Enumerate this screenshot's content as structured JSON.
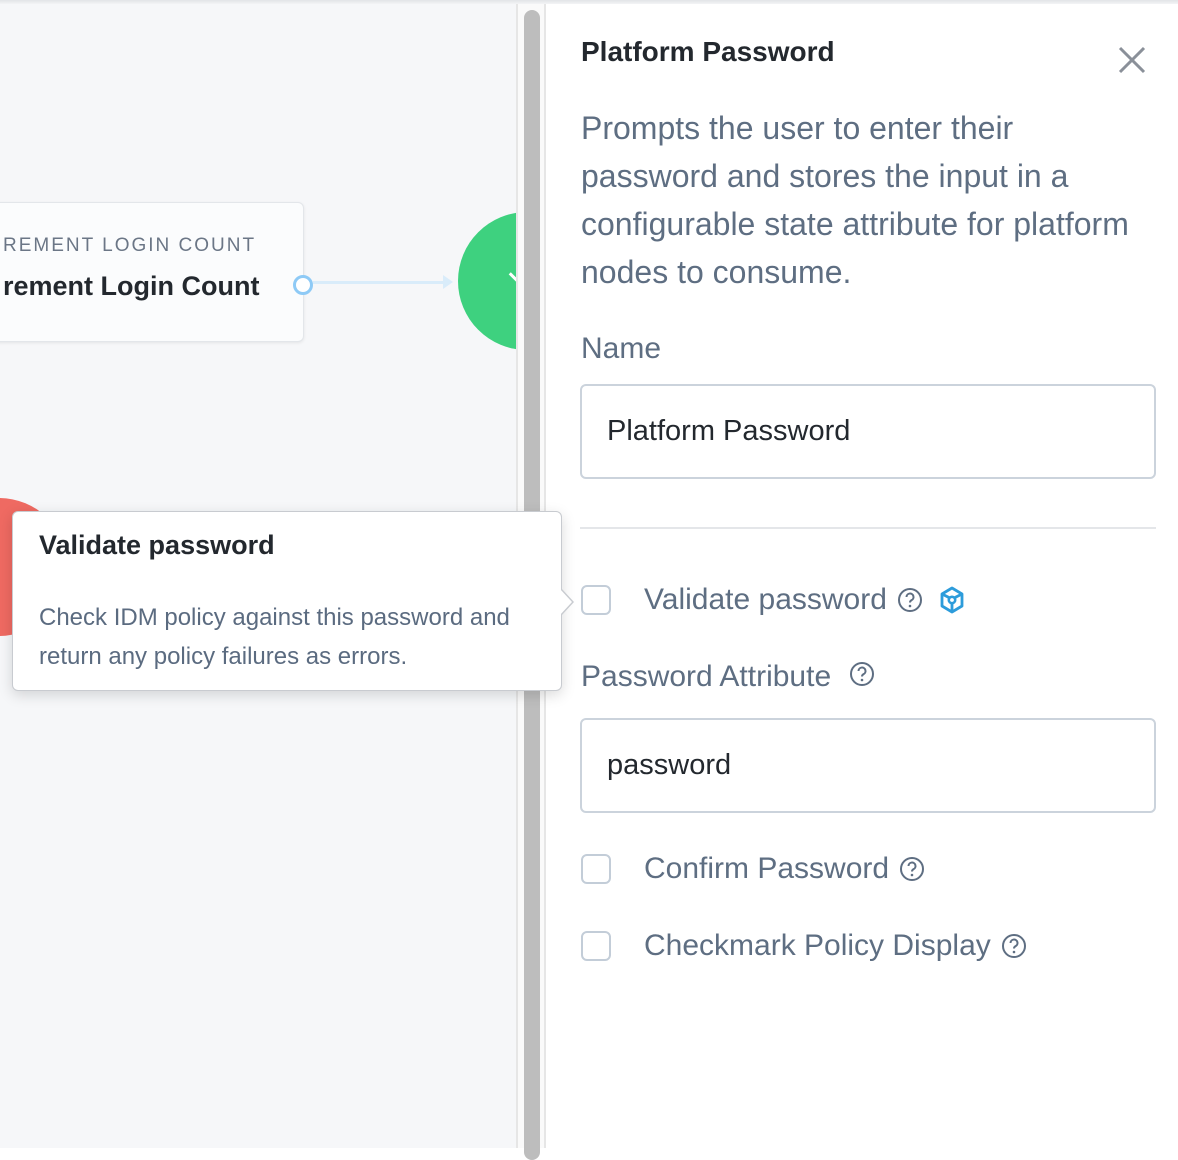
{
  "canvas": {
    "node_card": {
      "type_label": "REMENT LOGIN COUNT",
      "title": "rement Login Count"
    },
    "colors": {
      "success_node": "#3ed17f",
      "failure_node": "#ef6a62",
      "connector": "#d9ecfa",
      "port": "#8ecaf6"
    }
  },
  "tooltip": {
    "title": "Validate password",
    "body": "Check IDM policy against this password and return any policy failures as errors."
  },
  "panel": {
    "title": "Platform Password",
    "close_icon": "close-icon",
    "description": "Prompts the user to enter their password and stores the input in a configurable state attribute for platform nodes to consume.",
    "name_label": "Name",
    "name_value": "Platform Password",
    "validate_password": {
      "label": "Validate password",
      "checked": false,
      "help_icon": "question-circle-icon",
      "extra_icon": "cube-icon"
    },
    "password_attribute_label": "Password Attribute",
    "password_attribute_value": "password",
    "confirm_password": {
      "label": "Confirm Password",
      "checked": false,
      "help_icon": "question-circle-icon"
    },
    "checkmark_policy_display": {
      "label": "Checkmark Policy Display",
      "checked": false,
      "help_icon": "question-circle-icon"
    },
    "accent_color": "#2d9cdb"
  }
}
